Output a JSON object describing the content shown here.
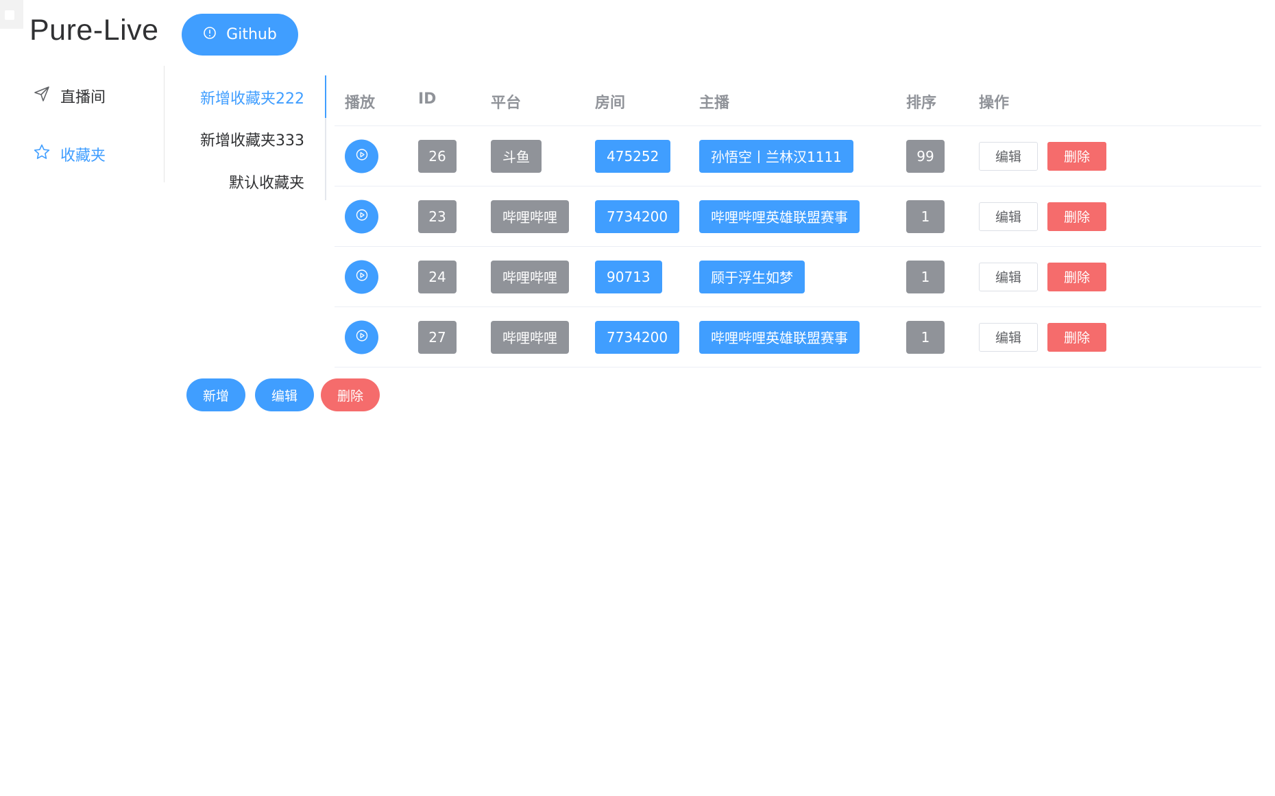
{
  "app": {
    "title": "Pure-Live",
    "github_label": "Github"
  },
  "nav": {
    "items": [
      {
        "label": "直播间",
        "icon": "send-icon",
        "active": false
      },
      {
        "label": "收藏夹",
        "icon": "star-icon",
        "active": true
      }
    ]
  },
  "folders": {
    "tabs": [
      {
        "label": "新增收藏夹222",
        "active": true
      },
      {
        "label": "新增收藏夹333",
        "active": false
      },
      {
        "label": "默认收藏夹",
        "active": false
      }
    ]
  },
  "table": {
    "headers": {
      "play": "播放",
      "id": "ID",
      "platform": "平台",
      "room": "房间",
      "anchor": "主播",
      "sort": "排序",
      "ops": "操作"
    },
    "rows": [
      {
        "id": "26",
        "platform": "斗鱼",
        "room": "475252",
        "anchor": "孙悟空丨兰林汉1111",
        "sort": "99",
        "edit": "编辑",
        "delete": "删除"
      },
      {
        "id": "23",
        "platform": "哔哩哔哩",
        "room": "7734200",
        "anchor": "哔哩哔哩英雄联盟赛事",
        "sort": "1",
        "edit": "编辑",
        "delete": "删除"
      },
      {
        "id": "24",
        "platform": "哔哩哔哩",
        "room": "90713",
        "anchor": "顾于浮生如梦",
        "sort": "1",
        "edit": "编辑",
        "delete": "删除"
      },
      {
        "id": "27",
        "platform": "哔哩哔哩",
        "room": "7734200",
        "anchor": "哔哩哔哩英雄联盟赛事",
        "sort": "1",
        "edit": "编辑",
        "delete": "删除"
      }
    ]
  },
  "actions": {
    "add_label": "新增",
    "edit_label": "编辑",
    "delete_label": "删除"
  },
  "colors": {
    "primary": "#409eff",
    "danger": "#f56c6c",
    "info": "#909399"
  }
}
